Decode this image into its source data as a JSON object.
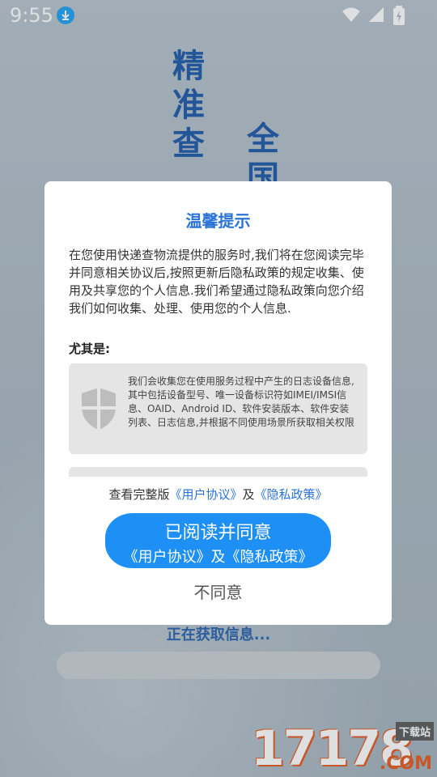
{
  "status_bar": {
    "time": "9:55"
  },
  "background": {
    "headline_left": "精准查",
    "headline_right": "全国",
    "loading_text": "正在获取信息...",
    "watermark_number": "17178",
    "watermark_tag": "下载站",
    "watermark_domain": ".COM",
    "accent_color": "#1b57a8"
  },
  "dialog": {
    "title": "温馨提示",
    "body": "在您使用快递查物流提供的服务时,我们将在您阅读完毕并同意相关协议后,按照更新后隐私政策的规定收集、使用及共享您的个人信息.我们希望通过隐私政策向您介绍我们如何收集、处理、使用您的个人信息.",
    "especially_label": "尤其是:",
    "cards": [
      {
        "icon": "shield-icon",
        "text": "我们会收集您在使用服务过程中产生的日志设备信息,其中包括设备型号、唯一设备标识符如IMEI/IMSI信息、OAID、Android ID、软件安装版本、软件安装列表、日志信息,并根据不同使用场景所获取相关权限"
      }
    ],
    "links": {
      "prefix": "查看完整版",
      "user_agreement": "《用户协议》",
      "and": "及",
      "privacy_policy": "《隐私政策》"
    },
    "agree_button": {
      "line1": "已阅读并同意",
      "line2": "《用户协议》及《隐私政策》",
      "color": "#1e8ff5"
    },
    "disagree_button": "不同意"
  }
}
